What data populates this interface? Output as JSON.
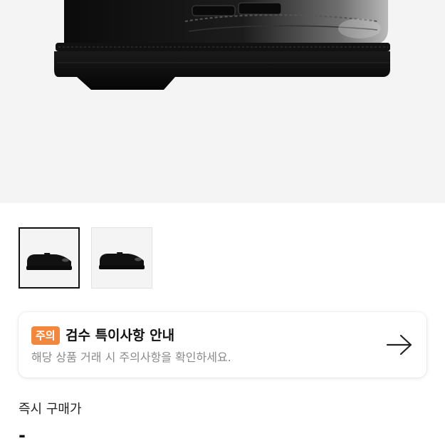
{
  "gallery": {
    "hero_image": "black-leather-loafer-photo",
    "thumbnails": [
      {
        "name": "loafer-thumbnail-1",
        "selected": true
      },
      {
        "name": "loafer-thumbnail-2",
        "selected": false
      }
    ]
  },
  "inspection_notice": {
    "badge": "주의",
    "title": "검수 특이사항 안내",
    "description": "해당 상품 거래 시 주의사항을 확인하세요.",
    "icon": "arrow-right-icon",
    "badge_color": "#f0883f"
  },
  "price": {
    "label": "즉시 구매가",
    "value": "-"
  }
}
